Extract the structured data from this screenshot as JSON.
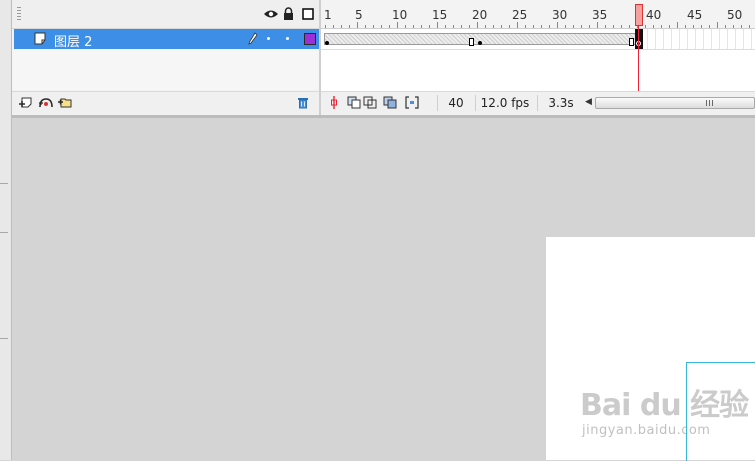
{
  "timeline": {
    "ruler_labels": [
      "1",
      "5",
      "10",
      "15",
      "20",
      "25",
      "30",
      "35",
      "40",
      "45",
      "50"
    ],
    "layer": {
      "name": "图层 2",
      "outline_color": "#9a30d8"
    },
    "status": {
      "current_frame": "40",
      "frame_rate": "12.0 fps",
      "elapsed_time": "3.3s",
      "scroll_grip": "III"
    },
    "header_icons": [
      "eye-icon",
      "lock-icon",
      "outline-icon"
    ],
    "footer_icons": [
      "insert-layer-icon",
      "add-motion-guide-icon",
      "insert-folder-icon",
      "delete-layer-icon"
    ]
  },
  "watermark": {
    "main": "Bai du 经验",
    "sub": "jingyan.baidu.com"
  },
  "colors": {
    "selection": "#3d8ee6",
    "playhead": "#e23333",
    "guide": "#35b7d6",
    "workspace": "#d4d4d4",
    "stage": "#ffffff"
  }
}
